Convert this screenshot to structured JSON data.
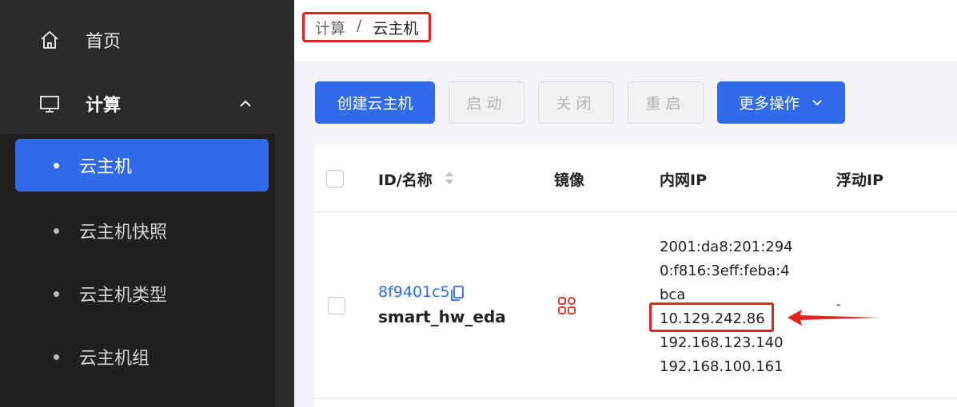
{
  "sidebar": {
    "items": [
      {
        "label": "首页",
        "icon": "home-icon"
      },
      {
        "label": "计算",
        "icon": "monitor-icon",
        "expanded": true
      }
    ],
    "sub_items": [
      {
        "label": "云主机",
        "active": true
      },
      {
        "label": "云主机快照",
        "active": false
      },
      {
        "label": "云主机类型",
        "active": false
      },
      {
        "label": "云主机组",
        "active": false
      }
    ]
  },
  "breadcrumb": {
    "parent": "计算",
    "separator": "/",
    "current": "云主机"
  },
  "toolbar": {
    "create_label": "创建云主机",
    "start_label": "启动",
    "stop_label": "关闭",
    "reboot_label": "重启",
    "more_label": "更多操作"
  },
  "table": {
    "columns": {
      "id_name": "ID/名称",
      "image": "镜像",
      "private_ip": "内网IP",
      "floating_ip": "浮动IP"
    },
    "rows": [
      {
        "id": "8f9401c5",
        "name": "smart_hw_eda",
        "ip_lines": [
          "2001:da8:201:294",
          "0:f816:3eff:feba:4",
          "bca",
          "10.129.242.86",
          "192.168.123.140",
          "192.168.100.161"
        ],
        "floating_ip": "-"
      }
    ]
  },
  "colors": {
    "accent": "#2f6ae8",
    "highlight": "#e0261c",
    "sidebar": "#2a2a2c"
  }
}
